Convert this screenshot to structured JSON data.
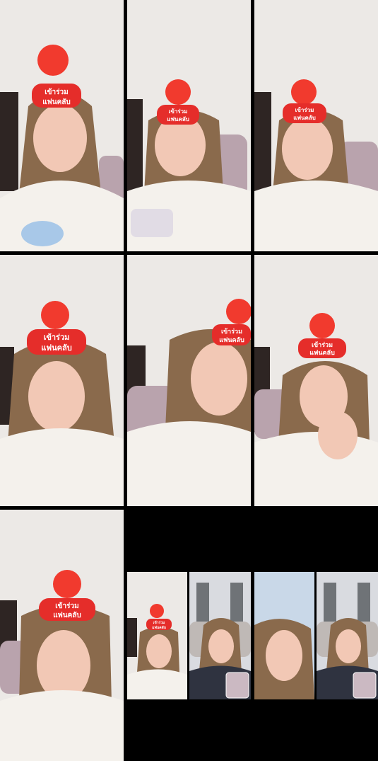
{
  "effect": {
    "badge_line1": "เข้าร่วม",
    "badge_line2": "แฟนคลับ"
  },
  "colors": {
    "wall": "#ece9e6",
    "door": "#2e2523",
    "chair": "#b9a3ad",
    "shirt": "#f4f1ec",
    "hair": "#8a6a4c",
    "skin": "#f2c8b5",
    "badge": "#e52d2a",
    "heart": "#f13a2e"
  },
  "tiles": [
    {
      "id": "t1",
      "has_badge": true
    },
    {
      "id": "t2",
      "has_badge": true
    },
    {
      "id": "t3",
      "has_badge": true
    },
    {
      "id": "t4",
      "has_badge": true
    },
    {
      "id": "t5",
      "has_badge": true
    },
    {
      "id": "t6",
      "has_badge": true
    },
    {
      "id": "t7",
      "has_badge": true
    },
    {
      "id": "t8",
      "has_badge": true
    },
    {
      "id": "t9",
      "has_badge": false
    },
    {
      "id": "t10",
      "has_badge": false
    },
    {
      "id": "t11",
      "has_badge": false
    }
  ]
}
